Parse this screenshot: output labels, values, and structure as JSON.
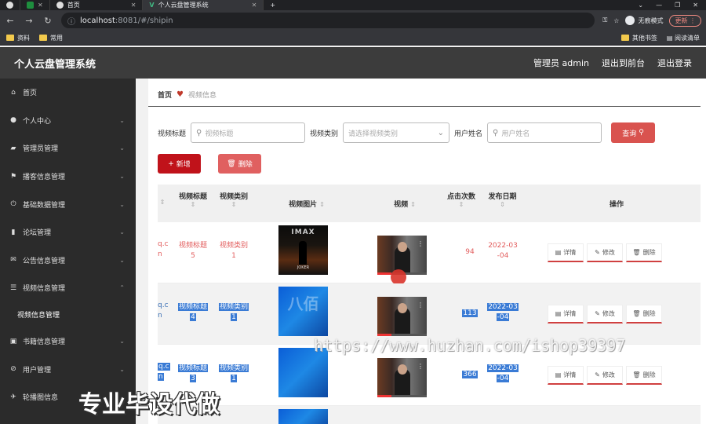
{
  "browser": {
    "tabs": [
      {
        "label": "首页",
        "active": false
      },
      {
        "label": "个人云盘管理系统",
        "active": true
      }
    ],
    "url_host": "localhost",
    "url_path": ":8081/#/shipin",
    "incognito_label": "无痕模式",
    "update_label": "更新",
    "bookmarks": [
      "资料",
      "常用"
    ],
    "bookmarks_right": [
      "其他书签",
      "阅读清单"
    ]
  },
  "app": {
    "title": "个人云盘管理系统",
    "user_label": "管理员 admin",
    "to_front": "退出到前台",
    "logout": "退出登录"
  },
  "sidebar": {
    "items": [
      {
        "label": "首页",
        "icon": "home-icon",
        "chevron": ""
      },
      {
        "label": "个人中心",
        "icon": "user-icon",
        "chevron": "⌄"
      },
      {
        "label": "管理员管理",
        "icon": "admin-icon",
        "chevron": "⌄"
      },
      {
        "label": "播客信息管理",
        "icon": "flag-icon",
        "chevron": "⌄"
      },
      {
        "label": "基础数据管理",
        "icon": "power-icon",
        "chevron": "⌄"
      },
      {
        "label": "论坛管理",
        "icon": "chart-icon",
        "chevron": "⌄"
      },
      {
        "label": "公告信息管理",
        "icon": "mail-icon",
        "chevron": "⌄"
      },
      {
        "label": "视频信息管理",
        "icon": "sliders-icon",
        "chevron": "⌃"
      }
    ],
    "sub_item": "视频信息管理",
    "items_after": [
      {
        "label": "书籍信息管理",
        "icon": "book-icon",
        "chevron": "⌄"
      },
      {
        "label": "用户管理",
        "icon": "users-icon",
        "chevron": "⌄"
      },
      {
        "label": "轮播图信息",
        "icon": "image-icon",
        "chevron": "⌄"
      }
    ]
  },
  "breadcrumb": {
    "home": "首页",
    "current": "视频信息"
  },
  "filter": {
    "title_label": "视频标题",
    "title_placeholder": "视频标题",
    "type_label": "视频类别",
    "type_placeholder": "请选择视频类别",
    "user_label": "用户姓名",
    "user_placeholder": "用户姓名",
    "query_label": "查询"
  },
  "actions": {
    "add_label": "新增",
    "delete_label": "删除"
  },
  "table": {
    "headers": {
      "title": "视频标题",
      "type": "视频类别",
      "image": "视频图片",
      "video": "视频",
      "clicks": "点击次数",
      "date": "发布日期",
      "ops": "操作"
    },
    "rows": [
      {
        "trunc1": "q.c",
        "trunc2": "n",
        "title1": "视频标题",
        "title2": "5",
        "type1": "视频类别",
        "type2": "1",
        "clicks": "94",
        "date1": "2022-03",
        "date2": "-04",
        "poster_top": "IMAX",
        "poster_bottom": "JOKER"
      },
      {
        "trunc1": "q.c",
        "trunc2": "n",
        "title1": "视频标题",
        "title2": "4",
        "type1": "视频类别",
        "type2": "1",
        "clicks": "113",
        "date1": "2022-03",
        "date2": "-04",
        "poster_text": "八佰"
      },
      {
        "trunc1": "q.c",
        "trunc2": "n",
        "title1": "视频标题",
        "title2": "3",
        "type1": "视频类别",
        "type2": "1",
        "clicks": "366",
        "date1": "2022-03",
        "date2": "-04"
      }
    ],
    "op_labels": {
      "detail": "详情",
      "edit": "修改",
      "delete": "删除"
    }
  },
  "watermarks": {
    "url": "https://www.huzhan.com/ishop39397",
    "caption": "专业毕设代做"
  }
}
